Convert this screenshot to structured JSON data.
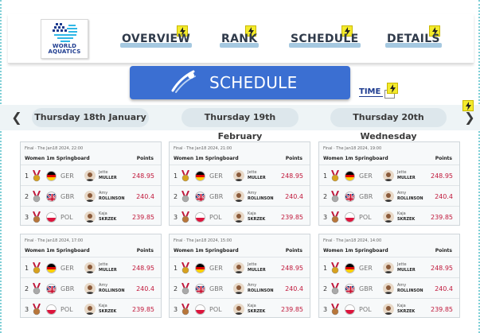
{
  "logo": {
    "line1": "WORLD",
    "line2": "AQUATICS"
  },
  "nav": {
    "items": [
      "OVERVIEW",
      "RANK",
      "SCHEDULE",
      "DETAILS"
    ],
    "highlight_color": "#a5c8e0",
    "bolt_color": "#f3ea2c"
  },
  "banner": {
    "title": "SCHEDULE",
    "color": "#3b6fd2"
  },
  "time": {
    "label": "TIME"
  },
  "dates": [
    "Thursday 18th January",
    "Thursday 19th February",
    "Thursday 20th Wednesday"
  ],
  "cards": [
    {
      "header": "Final · The Jan18 2024, 22:00",
      "event": "Women 1m Springboard",
      "points_label": "Points"
    },
    {
      "header": "Final · The Jan18 2024, 21:00",
      "event": "Women 1m Springboard",
      "points_label": "Points"
    },
    {
      "header": "Final · The Jan18 2024, 19:00",
      "event": "Women 1m Springboard",
      "points_label": "Points"
    },
    {
      "header": "Final · The Jan18 2024, 17:00",
      "event": "Women 1m Springboard",
      "points_label": "Points"
    },
    {
      "header": "Final · The Jan18 2024, 15:00",
      "event": "Women 1m Springboard",
      "points_label": "Points"
    },
    {
      "header": "Final · The Jan18 2024, 14:00",
      "event": "Women 1m Springboard",
      "points_label": "Points"
    }
  ],
  "results": [
    {
      "rank": "1",
      "country": "GER",
      "first": "Jette",
      "last": "MULLER",
      "score": "248.95",
      "medal_color": "#d8a21e"
    },
    {
      "rank": "2",
      "country": "GBR",
      "first": "Amy",
      "last": "ROLLINSON",
      "score": "240.4",
      "medal_color": "#a9a9a9"
    },
    {
      "rank": "3",
      "country": "POL",
      "first": "Kaja",
      "last": "SKRZEK",
      "score": "239.85",
      "medal_color": "#b8763a"
    }
  ],
  "score_color": "#c0173a"
}
